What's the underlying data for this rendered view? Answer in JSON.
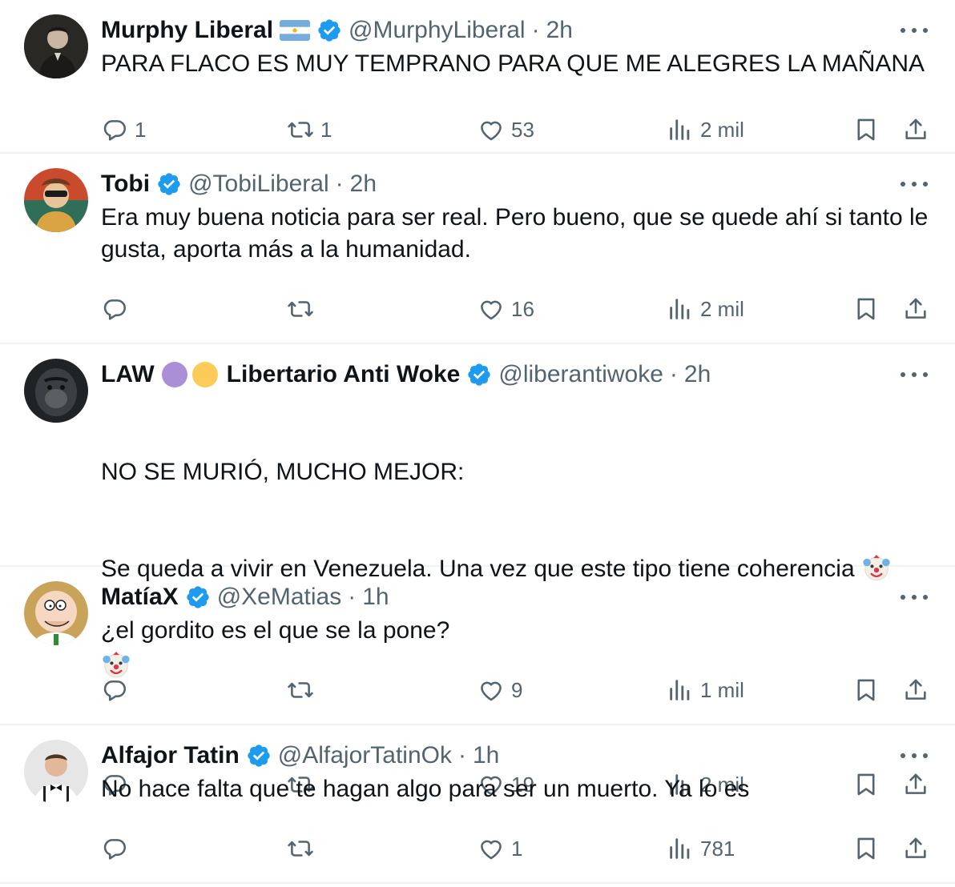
{
  "tweets": [
    {
      "name": "Murphy Liberal",
      "handle": "@MurphyLiberal",
      "time": "2h",
      "text": "PARA FLACO ES MUY TEMPRANO PARA QUE ME ALEGRES LA MAÑANA",
      "replies": "1",
      "retweets": "1",
      "likes": "53",
      "views": "2 mil",
      "name_emoji": "flag-argentina-icon"
    },
    {
      "name": "Tobi",
      "handle": "@TobiLiberal",
      "time": "2h",
      "text": "Era muy buena noticia para ser real. Pero bueno, que se quede ahí si tanto le gusta, aporta más a la humanidad.",
      "replies": "",
      "retweets": "",
      "likes": "16",
      "views": "2 mil"
    },
    {
      "name_prefix": "LAW",
      "name_suffix": "Libertario Anti Woke",
      "handle": "@liberantiwoke",
      "time": "2h",
      "text_line1": "NO SE MURIÓ, MUCHO MEJOR:",
      "text_line2": "Se queda a vivir en Venezuela. Una vez que este tipo tiene coherencia",
      "replies": "",
      "retweets": "",
      "likes": "19",
      "views": "2 mil"
    },
    {
      "name": "MatíaX",
      "handle": "@XeMatias",
      "time": "1h",
      "text": "¿el gordito es el que se la pone?",
      "replies": "",
      "retweets": "",
      "likes": "9",
      "views": "1 mil"
    },
    {
      "name": "Alfajor Tatin",
      "handle": "@AlfajorTatinOk",
      "time": "1h",
      "text": "No hace falta que te hagan algo para ser un muerto. Ya lo es",
      "replies": "",
      "retweets": "",
      "likes": "1",
      "views": "781"
    }
  ],
  "separator": "·",
  "colors": {
    "text": "#0f1419",
    "secondary": "#536471",
    "verified": "#1d9bf0",
    "divider": "#eff3f4",
    "purple_circle": "#aa8ed6",
    "yellow_circle": "#fdcb58"
  }
}
